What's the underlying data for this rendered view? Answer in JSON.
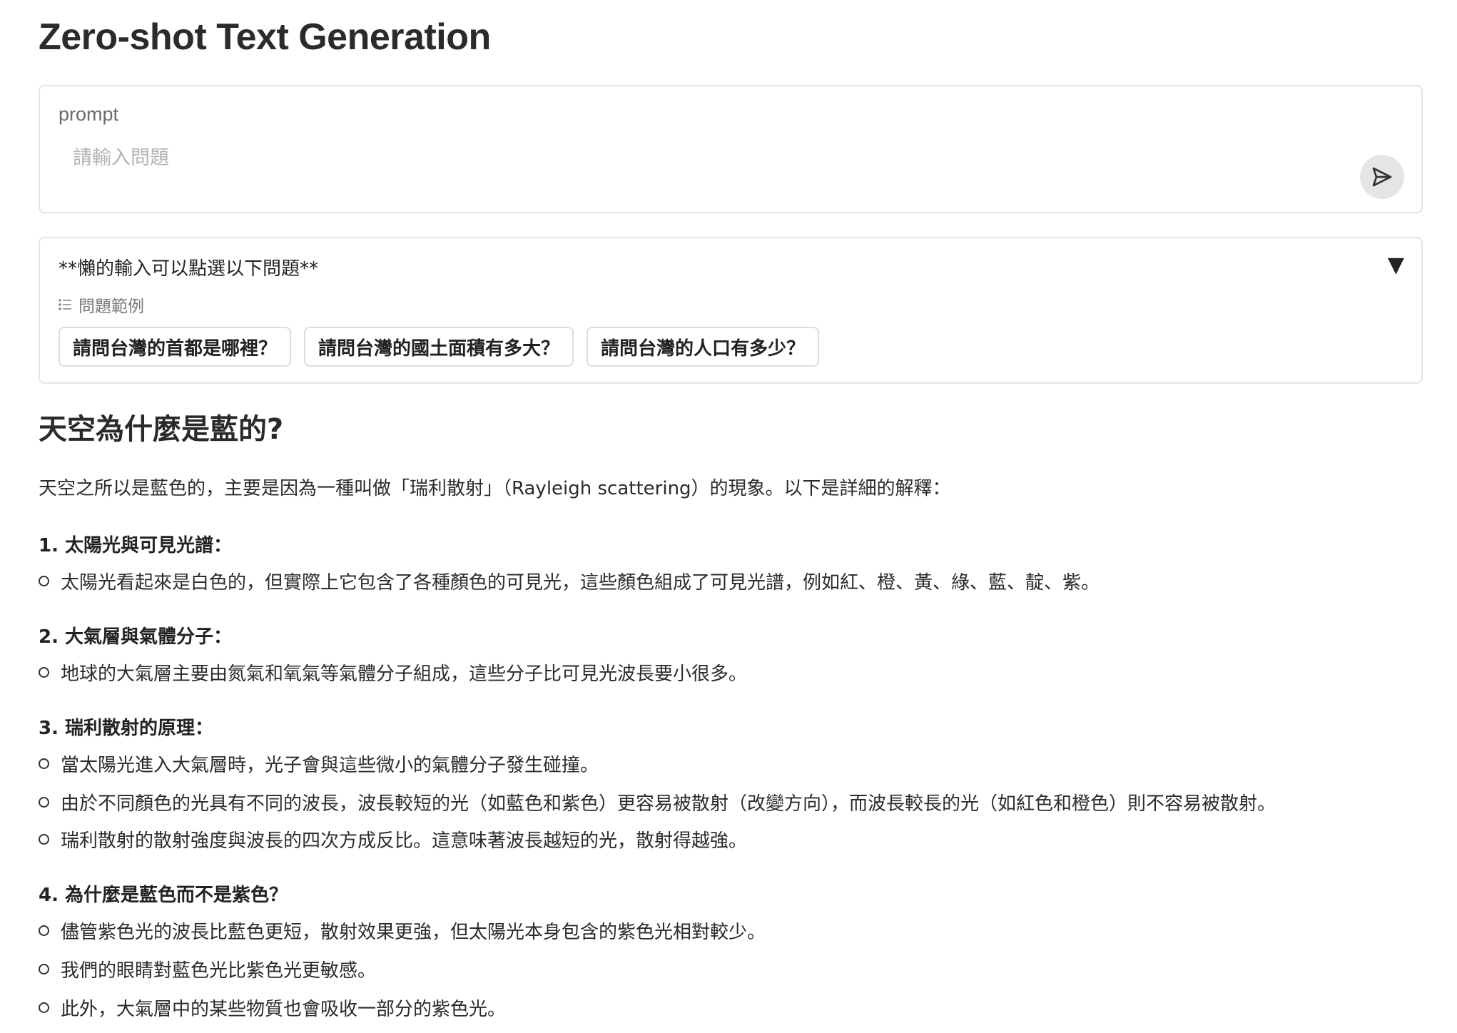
{
  "app": {
    "title": "Zero-shot Text Generation"
  },
  "prompt": {
    "label": "prompt",
    "placeholder": "請輸入問題",
    "value": ""
  },
  "examples": {
    "header": "**懶的輸入可以點選以下問題**",
    "label": "問題範例",
    "items": [
      "請問台灣的首都是哪裡？",
      "請問台灣的國土面積有多大？",
      "請問台灣的人口有多少？"
    ]
  },
  "answer": {
    "heading": "天空為什麼是藍的?",
    "intro": "天空之所以是藍色的，主要是因為一種叫做「瑞利散射」（Rayleigh scattering）的現象。以下是詳細的解釋：",
    "sections": [
      {
        "title": "1. 太陽光與可見光譜：",
        "bullets": [
          "太陽光看起來是白色的，但實際上它包含了各種顏色的可見光，這些顏色組成了可見光譜，例如紅、橙、黃、綠、藍、靛、紫。"
        ]
      },
      {
        "title": "2. 大氣層與氣體分子：",
        "bullets": [
          "地球的大氣層主要由氮氣和氧氣等氣體分子組成，這些分子比可見光波長要小很多。"
        ]
      },
      {
        "title": "3. 瑞利散射的原理：",
        "bullets": [
          "當太陽光進入大氣層時，光子會與這些微小的氣體分子發生碰撞。",
          "由於不同顏色的光具有不同的波長，波長較短的光（如藍色和紫色）更容易被散射（改變方向），而波長較長的光（如紅色和橙色）則不容易被散射。",
          "瑞利散射的散射強度與波長的四次方成反比。這意味著波長越短的光，散射得越強。"
        ]
      },
      {
        "title": "4. 為什麼是藍色而不是紫色？",
        "bullets": [
          "儘管紫色光的波長比藍色更短，散射效果更強，但太陽光本身包含的紫色光相對較少。",
          "我們的眼睛對藍色光比紫色光更敏感。",
          "此外，大氣層中的某些物質也會吸收一部分的紫色光。"
        ]
      }
    ]
  },
  "icons": {
    "send": "send-icon",
    "collapse": "triangle-down-icon",
    "list": "list-icon"
  },
  "colors": {
    "border": "#e3e4e8",
    "send_bg": "#e5e5e5",
    "text": "#2b2b2b"
  }
}
